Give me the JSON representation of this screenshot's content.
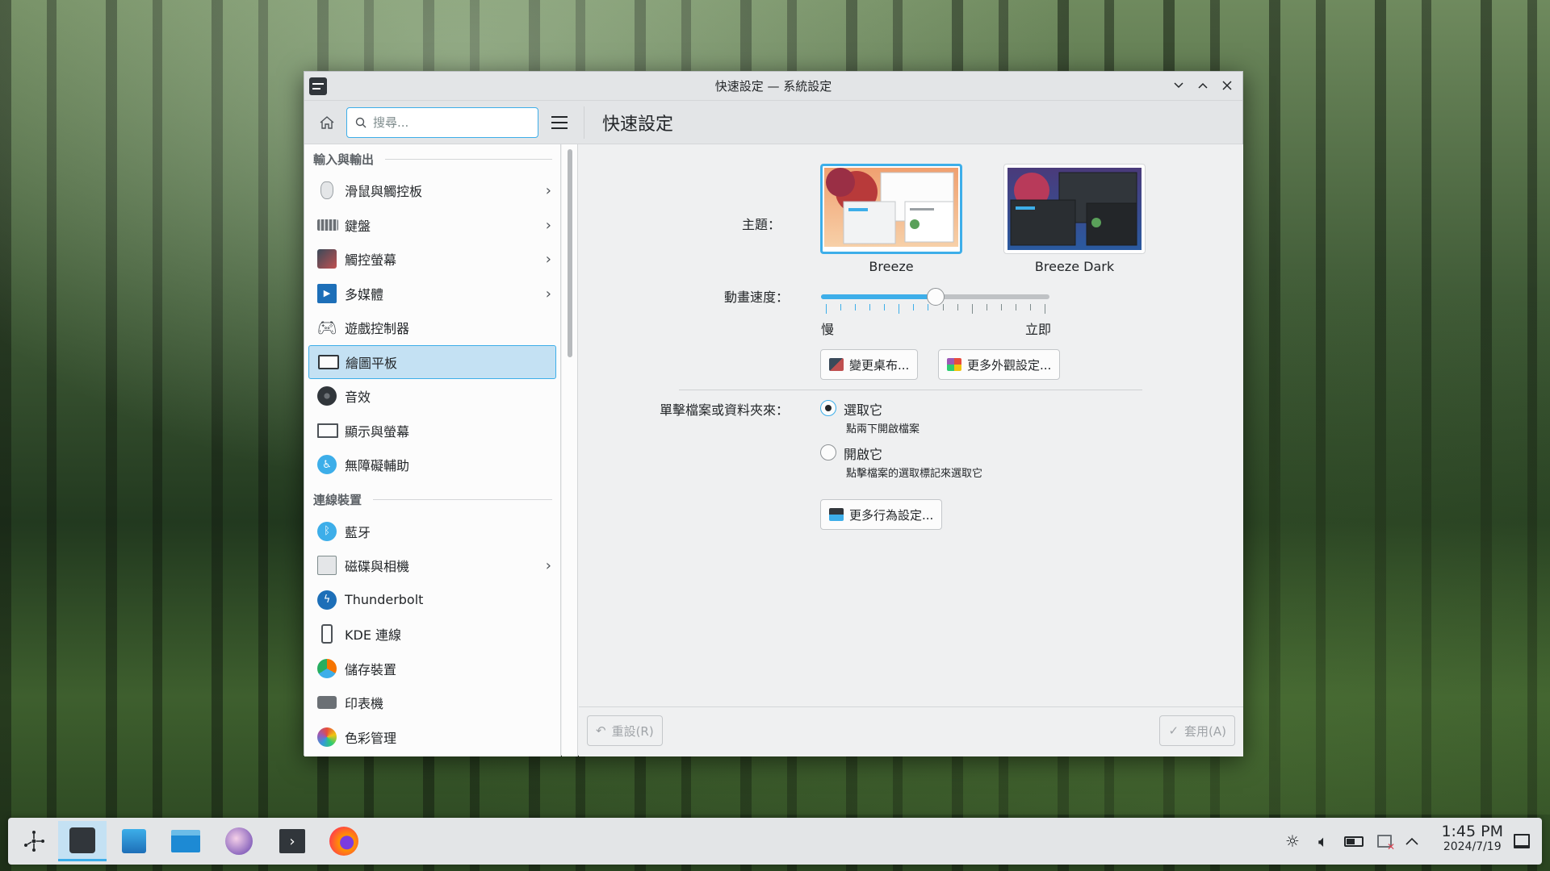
{
  "window": {
    "title": "快速設定 — 系統設定",
    "controls": [
      "chevron-down-icon",
      "chevron-up-icon",
      "close-icon"
    ]
  },
  "toolbar": {
    "search_placeholder": "搜尋...",
    "page_title": "快速設定"
  },
  "sidebar": {
    "sections": [
      {
        "header": "輸入與輸出",
        "items": [
          {
            "label": "滑鼠與觸控板",
            "icon": "mouse-icon",
            "chevron": true
          },
          {
            "label": "鍵盤",
            "icon": "keyboard-icon",
            "chevron": true
          },
          {
            "label": "觸控螢幕",
            "icon": "touchscreen-icon",
            "chevron": true
          },
          {
            "label": "多媒體",
            "icon": "multimedia-icon",
            "chevron": true
          },
          {
            "label": "遊戲控制器",
            "icon": "gamepad-icon",
            "chevron": false
          },
          {
            "label": "繪圖平板",
            "icon": "drawing-tablet-icon",
            "chevron": false,
            "active": true
          },
          {
            "label": "音效",
            "icon": "speaker-icon",
            "chevron": false
          },
          {
            "label": "顯示與螢幕",
            "icon": "display-icon",
            "chevron": false
          },
          {
            "label": "無障礙輔助",
            "icon": "accessibility-icon",
            "chevron": false
          }
        ]
      },
      {
        "header": "連線裝置",
        "items": [
          {
            "label": "藍牙",
            "icon": "bluetooth-icon",
            "chevron": false
          },
          {
            "label": "磁碟與相機",
            "icon": "disk-icon",
            "chevron": true
          },
          {
            "label": "Thunderbolt",
            "icon": "thunderbolt-icon",
            "chevron": false
          },
          {
            "label": "KDE 連線",
            "icon": "kdeconnect-icon",
            "chevron": false
          },
          {
            "label": "儲存裝置",
            "icon": "storage-icon",
            "chevron": false
          },
          {
            "label": "印表機",
            "icon": "printer-icon",
            "chevron": false
          },
          {
            "label": "色彩管理",
            "icon": "color-icon",
            "chevron": false
          }
        ]
      }
    ]
  },
  "settings": {
    "theme_label": "主題：",
    "themes": [
      {
        "name": "Breeze",
        "selected": true
      },
      {
        "name": "Breeze Dark",
        "selected": false
      }
    ],
    "animation_label": "動畫速度：",
    "animation": {
      "min_label": "慢",
      "max_label": "立即",
      "value_fraction": 0.5,
      "tick_count": 16
    },
    "change_wallpaper_button": "變更桌布...",
    "more_appearance_button": "更多外觀設定...",
    "click_label": "單擊檔案或資料夾來：",
    "click_options": [
      {
        "label": "選取它",
        "desc": "點兩下開啟檔案",
        "checked": true
      },
      {
        "label": "開啟它",
        "desc": "點擊檔案的選取標記來選取它",
        "checked": false
      }
    ],
    "more_behavior_button": "更多行為設定..."
  },
  "footer": {
    "reset_button": "重設(R)",
    "apply_button": "套用(A)"
  },
  "taskbar": {
    "apps": [
      "app-launcher-icon",
      "system-settings-icon",
      "discover-icon",
      "dolphin-icon",
      "kdeconnect-app-icon",
      "konsole-icon",
      "firefox-icon"
    ],
    "time": "1:45 PM",
    "date": "2024/7/19"
  },
  "colors": {
    "accent": "#3daee9",
    "selection_bg": "#c4e1f3",
    "window_bg": "#eff0f1"
  }
}
